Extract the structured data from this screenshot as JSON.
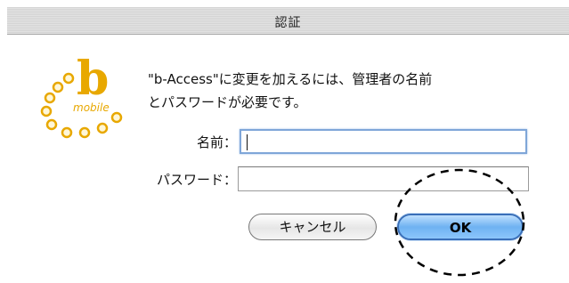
{
  "dialog": {
    "title": "認証",
    "message_line1": "\"b-Access\"に変更を加えるには、管理者の名前",
    "message_line2": "とパスワードが必要です。"
  },
  "logo": {
    "letter": "b",
    "word": "mobile",
    "brand_color": "#e8a800"
  },
  "form": {
    "name_label": "名前：",
    "name_value": "",
    "password_label": "パスワード：",
    "password_value": ""
  },
  "buttons": {
    "cancel_label": "キャンセル",
    "ok_label": "OK"
  },
  "colors": {
    "focus_ring": "#7fa6d8",
    "default_button": "#6fb2f2"
  }
}
